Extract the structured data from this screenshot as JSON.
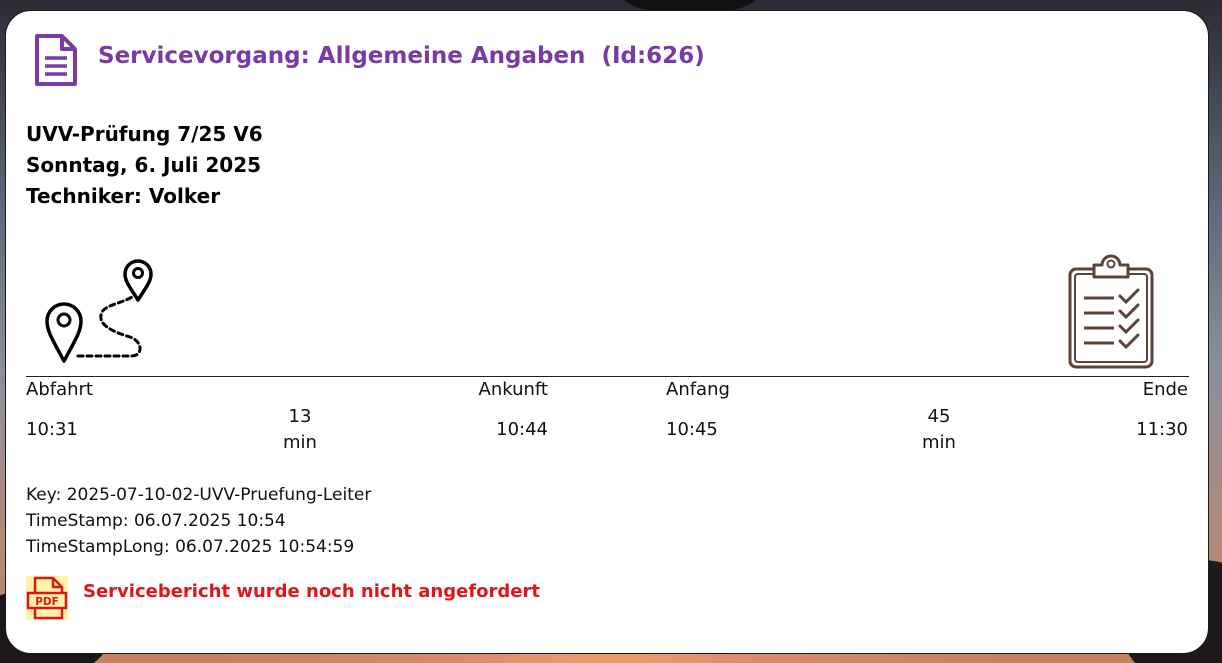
{
  "header": {
    "icon": "document-icon",
    "title": "Servicevorgang: Allgemeine Angaben  (Id:626)"
  },
  "info": {
    "order": "UVV-Prüfung 7/25 V6",
    "date": "Sonntag, 6. Juli 2025",
    "technician": "Techniker: Volker"
  },
  "icons": {
    "route": "route-map-pins-icon",
    "clipboard": "clipboard-checklist-icon",
    "pdf": "pdf-file-icon"
  },
  "timeline": {
    "departure_label": "Abfahrt",
    "departure_time": "10:31",
    "travel_duration": "13",
    "travel_unit": "min",
    "arrival_label": "Ankunft",
    "arrival_time": "10:44",
    "start_label": "Anfang",
    "start_time": "10:45",
    "work_duration": "45",
    "work_unit": "min",
    "end_label": "Ende",
    "end_time": "11:30"
  },
  "meta": {
    "key": "Key: 2025-07-10-02-UVV-Pruefung-Leiter",
    "timestamp": "TimeStamp: 06.07.2025 10:54",
    "timestamp_long": "TimeStampLong: 06.07.2025 10:54:59"
  },
  "report": {
    "status": "Servicebericht wurde noch nicht angefordert"
  },
  "colors": {
    "title": "#7a3aa5",
    "status": "#e0151b",
    "pdf_background": "#fff3a8",
    "pdf_icon": "#e0151b",
    "clipboard_icon": "#5a4338"
  }
}
